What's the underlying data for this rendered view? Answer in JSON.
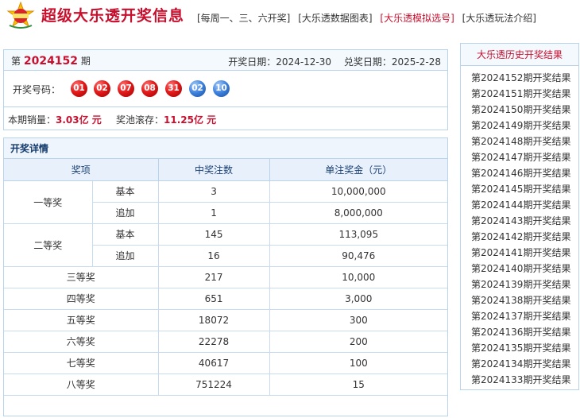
{
  "header": {
    "logo_icon": "lottery-logo-icon",
    "title": "超级大乐透开奖信息",
    "nav": [
      {
        "label": "[每周一、三、六开奖]",
        "active": false
      },
      {
        "label": "[大乐透数据图表]",
        "active": false
      },
      {
        "label": "[大乐透模拟选号]",
        "active": true
      },
      {
        "label": "[大乐透玩法介绍]",
        "active": false
      }
    ]
  },
  "draw": {
    "prefix": "第",
    "number": "2024152",
    "suffix": "期",
    "draw_date_label": "开奖日期：",
    "draw_date": "2024-12-30",
    "redeem_date_label": "兑奖日期：",
    "redeem_date": "2025-2-28",
    "balls_label": "开奖号码：",
    "red_balls": [
      "01",
      "02",
      "07",
      "08",
      "31"
    ],
    "blue_balls": [
      "02",
      "10"
    ],
    "sales_label": "本期销量：",
    "sales_value": "3.03亿 元",
    "pool_label": "奖池滚存：",
    "pool_value": "11.25亿 元",
    "colors": {
      "red": "#e21a1a",
      "blue": "#3b7fdc",
      "accent": "#c8102e"
    }
  },
  "details": {
    "title": "开奖详情",
    "headers": [
      "奖项",
      "中奖注数",
      "单注奖金（元）"
    ],
    "first_prize": {
      "name": "一等奖",
      "rows": [
        {
          "sub": "基本",
          "count": "3",
          "amount": "10,000,000"
        },
        {
          "sub": "追加",
          "count": "1",
          "amount": "8,000,000"
        }
      ]
    },
    "second_prize": {
      "name": "二等奖",
      "rows": [
        {
          "sub": "基本",
          "count": "145",
          "amount": "113,095"
        },
        {
          "sub": "追加",
          "count": "16",
          "amount": "90,476"
        }
      ]
    },
    "other_prizes": [
      {
        "name": "三等奖",
        "count": "217",
        "amount": "10,000"
      },
      {
        "name": "四等奖",
        "count": "651",
        "amount": "3,000"
      },
      {
        "name": "五等奖",
        "count": "18072",
        "amount": "300"
      },
      {
        "name": "六等奖",
        "count": "22278",
        "amount": "200"
      },
      {
        "name": "七等奖",
        "count": "40617",
        "amount": "100"
      },
      {
        "name": "八等奖",
        "count": "751224",
        "amount": "15"
      }
    ]
  },
  "history": {
    "title": "大乐透历史开奖结果",
    "items": [
      "第2024152期开奖结果",
      "第2024151期开奖结果",
      "第2024150期开奖结果",
      "第2024149期开奖结果",
      "第2024148期开奖结果",
      "第2024147期开奖结果",
      "第2024146期开奖结果",
      "第2024145期开奖结果",
      "第2024144期开奖结果",
      "第2024143期开奖结果",
      "第2024142期开奖结果",
      "第2024141期开奖结果",
      "第2024140期开奖结果",
      "第2024139期开奖结果",
      "第2024138期开奖结果",
      "第2024137期开奖结果",
      "第2024136期开奖结果",
      "第2024135期开奖结果",
      "第2024134期开奖结果",
      "第2024133期开奖结果"
    ]
  }
}
